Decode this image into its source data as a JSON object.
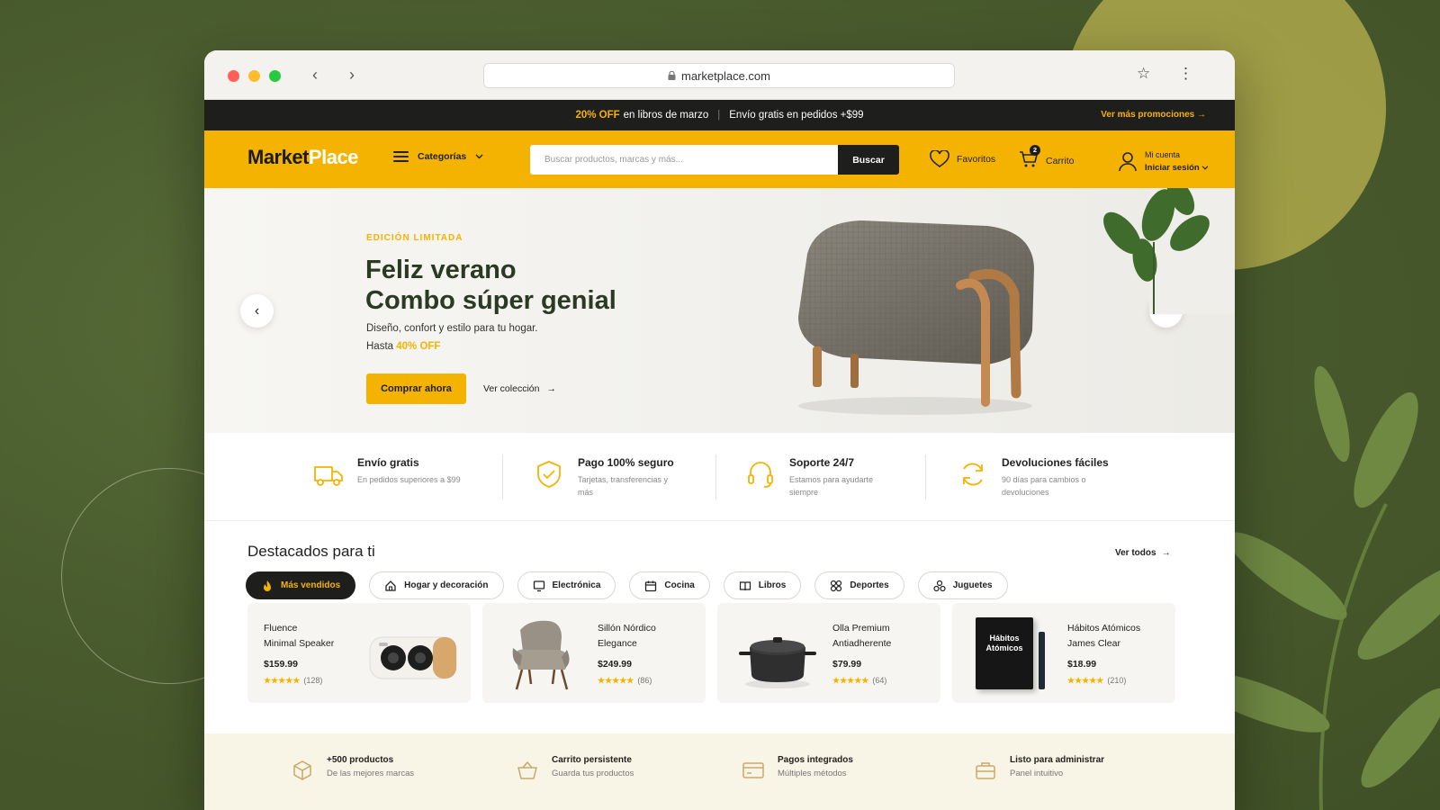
{
  "browser": {
    "url": "marketplace.com"
  },
  "promo": {
    "discount": "20% OFF",
    "discount_rest": "en libros de marzo",
    "shipping": "Envío gratis en pedidos +$99",
    "more": "Ver más promociones"
  },
  "header": {
    "logo_dark": "Market",
    "logo_light": "Place",
    "categories": "Categorías",
    "search_placeholder": "Buscar productos, marcas y más...",
    "search_button": "Buscar",
    "favorites": "Favoritos",
    "cart": "Carrito",
    "cart_count": "2",
    "account_label": "Mi cuenta",
    "account_action": "Iniciar sesión"
  },
  "hero": {
    "eyebrow": "EDICIÓN LIMITADA",
    "title_line1": "Feliz verano",
    "title_line2": "Combo súper genial",
    "description": "Diseño, confort y estilo para tu hogar.",
    "upto_prefix": "Hasta",
    "upto_value": "40% OFF",
    "cta": "Comprar ahora",
    "secondary": "Ver colección"
  },
  "features": [
    {
      "title": "Envío gratis",
      "sub": "En pedidos superiores a $99",
      "icon": "truck-icon"
    },
    {
      "title": "Pago 100% seguro",
      "sub": "Tarjetas, transferencias y más",
      "icon": "shield-check-icon"
    },
    {
      "title": "Soporte 24/7",
      "sub": "Estamos para ayudarte siempre",
      "icon": "headset-icon"
    },
    {
      "title": "Devoluciones fáciles",
      "sub": "90 días para cambios o devoluciones",
      "icon": "refresh-icon"
    }
  ],
  "featured": {
    "title": "Destacados para ti",
    "see_all": "Ver todos",
    "chips": [
      {
        "label": "Más vendidos",
        "icon": "fire-icon"
      },
      {
        "label": "Hogar y decoración",
        "icon": "home-icon"
      },
      {
        "label": "Electrónica",
        "icon": "monitor-icon"
      },
      {
        "label": "Cocina",
        "icon": "calendar-icon"
      },
      {
        "label": "Libros",
        "icon": "book-icon"
      },
      {
        "label": "Deportes",
        "icon": "sports-icon"
      },
      {
        "label": "Juguetes",
        "icon": "toy-icon"
      }
    ],
    "products": [
      {
        "name_line1": "Fluence",
        "name_line2": "Minimal Speaker",
        "price": "$159.99",
        "stars": "★★★★★",
        "reviews": "(128)"
      },
      {
        "name_line1": "Sillón Nórdico",
        "name_line2": "Elegance",
        "price": "$249.99",
        "stars": "★★★★★",
        "reviews": "(86)"
      },
      {
        "name_line1": "Olla Premium",
        "name_line2": "Antiadherente",
        "price": "$79.99",
        "stars": "★★★★★",
        "reviews": "(64)"
      },
      {
        "name_line1": "Hábitos Atómicos",
        "name_line2": "James Clear",
        "price": "$18.99",
        "stars": "★★★★★",
        "reviews": "(210)",
        "cover_title": "Hábitos Atómicos"
      }
    ]
  },
  "bottom": [
    {
      "title": "+500 productos",
      "sub": "De las mejores marcas",
      "icon": "cube-icon"
    },
    {
      "title": "Carrito persistente",
      "sub": "Guarda tus productos",
      "icon": "basket-icon"
    },
    {
      "title": "Pagos integrados",
      "sub": "Múltiples métodos",
      "icon": "card-icon"
    },
    {
      "title": "Listo para administrar",
      "sub": "Panel intuitivo",
      "icon": "briefcase-icon"
    }
  ],
  "colors": {
    "accent": "#f5b301",
    "dark": "#1e1e1c",
    "hero_title": "#2a3a23",
    "background": "#4a5d2e"
  }
}
